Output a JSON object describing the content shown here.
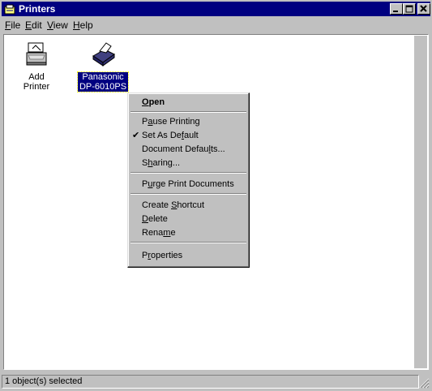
{
  "window": {
    "title": "Printers"
  },
  "menu": [
    {
      "pre": "",
      "u": "F",
      "post": "ile"
    },
    {
      "pre": "",
      "u": "E",
      "post": "dit"
    },
    {
      "pre": "",
      "u": "V",
      "post": "iew"
    },
    {
      "pre": "",
      "u": "H",
      "post": "elp"
    }
  ],
  "icons": {
    "add_printer": {
      "label": "Add Printer",
      "icon": "add-printer-icon"
    },
    "panasonic": {
      "label_line1": "Panasonic",
      "label_line2": "DP-6010PS",
      "icon": "printer-icon"
    }
  },
  "context_menu": {
    "open": {
      "pre": "",
      "u": "O",
      "post": "pen"
    },
    "pause": {
      "pre": "P",
      "u": "a",
      "post": "use Printing"
    },
    "set_default": {
      "pre": "Set As De",
      "u": "f",
      "post": "ault",
      "checked": "✔"
    },
    "doc_defaults": {
      "pre": "Document Defau",
      "u": "l",
      "post": "ts..."
    },
    "sharing": {
      "pre": "S",
      "u": "h",
      "post": "aring..."
    },
    "purge": {
      "pre": "P",
      "u": "u",
      "post": "rge Print Documents"
    },
    "create_shortcut": {
      "pre": "Create ",
      "u": "S",
      "post": "hortcut"
    },
    "delete": {
      "pre": "",
      "u": "D",
      "post": "elete"
    },
    "rename": {
      "pre": "Rena",
      "u": "m",
      "post": "e"
    },
    "properties": {
      "pre": "P",
      "u": "r",
      "post": "operties"
    }
  },
  "status": {
    "text": "1 object(s) selected"
  },
  "colors": {
    "title_bar": "#000080",
    "face": "#c0c0c0",
    "selection": "#000080"
  }
}
